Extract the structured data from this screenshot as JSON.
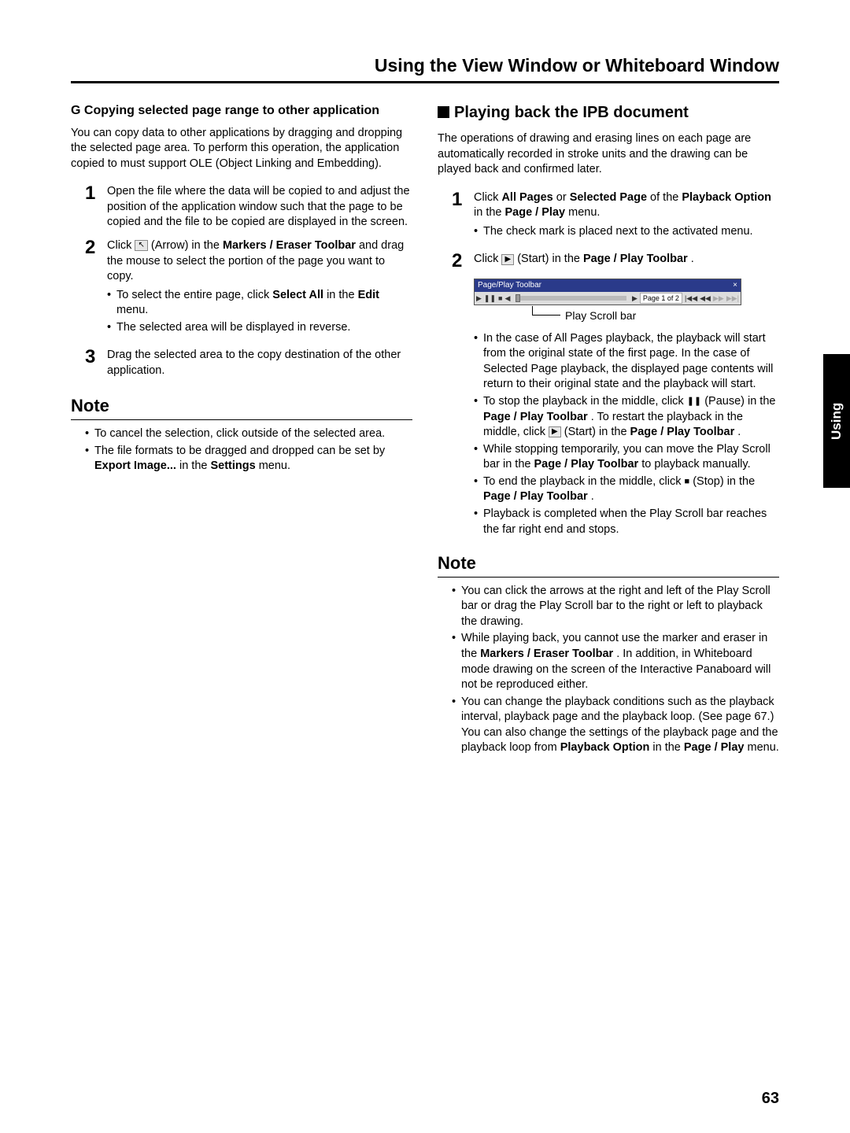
{
  "header": {
    "title": "Using the View Window or Whiteboard Window"
  },
  "sideTab": "Using",
  "pageNumber": "63",
  "left": {
    "subsection": "G Copying selected page range to other application",
    "intro": "You can copy data to other applications by dragging and dropping the selected page area. To perform this operation, the application copied to must support OLE (Object Linking and Embedding).",
    "steps": {
      "s1": "Open the file where the data will be copied to and adjust the position of the application window such that the page to be copied and the file to be copied are displayed in the screen.",
      "s2a": "Click ",
      "s2b": " (Arrow) in the ",
      "s2c": "Markers / Eraser Toolbar",
      "s2d": " and drag the mouse to select the portion of the page you want to copy.",
      "s2bullet1a": "To select the entire page, click ",
      "s2bullet1b": "Select All",
      "s2bullet1c": " in the ",
      "s2bullet1d": "Edit",
      "s2bullet1e": " menu.",
      "s2bullet2": "The selected area will be displayed in reverse.",
      "s3": "Drag the selected area to the copy destination of the other application."
    },
    "noteHeading": "Note",
    "notes": {
      "n1": "To cancel the selection, click outside of the selected area.",
      "n2a": "The file formats to be dragged and dropped can be set by ",
      "n2b": "Export Image...",
      "n2c": " in the ",
      "n2d": "Settings",
      "n2e": " menu."
    }
  },
  "right": {
    "heading": "Playing back the IPB document",
    "intro": "The operations of drawing and erasing lines on each page are automatically recorded in stroke units and the drawing can be played back and confirmed later.",
    "steps": {
      "s1a": "Click ",
      "s1b": "All Pages",
      "s1c": " or ",
      "s1d": "Selected Page",
      "s1e": " of the ",
      "s1f": "Playback Option",
      "s1g": " in the ",
      "s1h": "Page / Play",
      "s1i": " menu.",
      "s1bullet": "The check mark is placed next to the activated menu.",
      "s2a": "Click ",
      "s2b": " (Start) in the ",
      "s2c": "Page / Play Toolbar",
      "s2d": "."
    },
    "toolbar": {
      "title": "Page/Play Toolbar",
      "pageLabel": "Page 1 of 2",
      "callout": "Play Scroll bar"
    },
    "stepBullets": {
      "b1": "In the case of All Pages playback, the playback will start from the original state of the first page. In the case of Selected Page playback, the displayed page contents will return to their original state and the playback will start.",
      "b2a": "To stop the playback in the middle, click ",
      "b2b": " (Pause) in the ",
      "b2c": "Page / Play Toolbar",
      "b2d": ". To restart the playback in the middle, click ",
      "b2e": " (Start) in the ",
      "b2f": "Page / Play Toolbar",
      "b2g": ".",
      "b3a": "While stopping temporarily, you can move the Play Scroll bar in the ",
      "b3b": "Page / Play Toolbar",
      "b3c": " to playback manually.",
      "b4a": "To end the playback in the middle, click ",
      "b4b": " (Stop) in the ",
      "b4c": "Page / Play Toolbar",
      "b4d": ".",
      "b5": "Playback is completed when the Play Scroll bar reaches the far right end and stops."
    },
    "noteHeading": "Note",
    "notes": {
      "n1": "You can click the arrows at the right and left of the Play Scroll bar or drag the Play Scroll bar to the right or left to playback the drawing.",
      "n2a": "While playing back, you cannot use the marker and eraser in the ",
      "n2b": "Markers / Eraser Toolbar",
      "n2c": ". In addition, in Whiteboard mode drawing on the screen of the Interactive Panaboard will not be reproduced either.",
      "n3a": "You can change the playback conditions such as the playback interval, playback page and the playback loop. (See page 67.) You can also change the settings of the playback page and the playback loop from ",
      "n3b": "Playback Option",
      "n3c": " in the ",
      "n3d": "Page / Play",
      "n3e": " menu."
    }
  }
}
